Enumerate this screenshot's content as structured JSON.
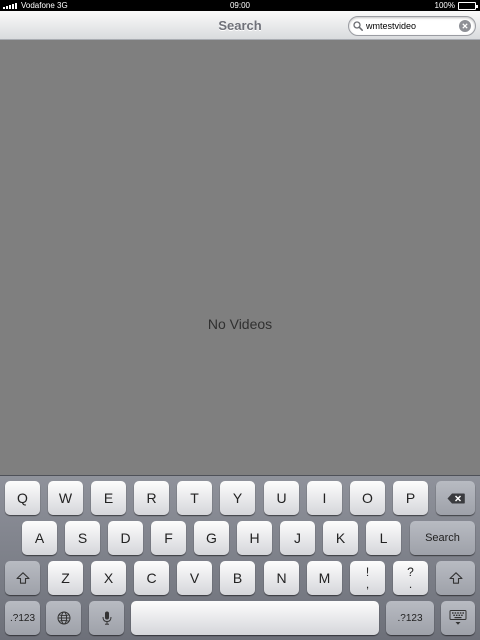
{
  "status_bar": {
    "carrier": "Vodafone 3G",
    "time": "09:00",
    "battery": "100%",
    "battery_level": 1.0
  },
  "nav_bar": {
    "title": "Search",
    "search": {
      "value": "wmtestvideo",
      "placeholder": ""
    }
  },
  "content": {
    "empty_message": "No Videos"
  },
  "keyboard": {
    "row1": [
      "Q",
      "W",
      "E",
      "R",
      "T",
      "Y",
      "U",
      "I",
      "O",
      "P"
    ],
    "row2": [
      "A",
      "S",
      "D",
      "F",
      "G",
      "H",
      "J",
      "K",
      "L"
    ],
    "search_key": "Search",
    "row3": [
      "Z",
      "X",
      "C",
      "V",
      "B",
      "N",
      "M"
    ],
    "punct_excl": {
      "top": "!",
      "bottom": ","
    },
    "punct_q": {
      "top": "?",
      "bottom": "."
    },
    "numbers_key": ".?123"
  }
}
